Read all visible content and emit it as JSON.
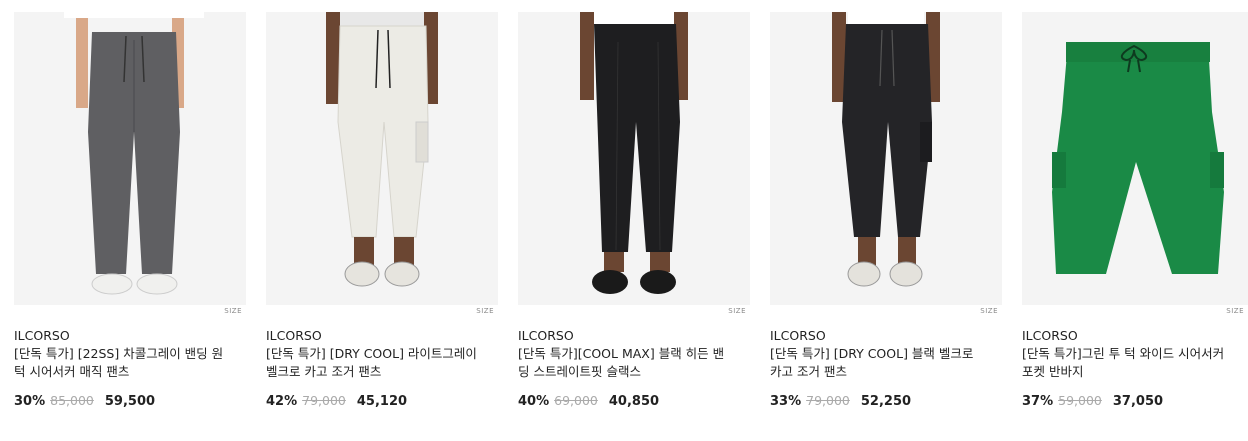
{
  "products": [
    {
      "size_label": "SIZE",
      "brand": "ILCORSO",
      "title": "[단독 특가] [22SS] 차콜그레이 밴딩 원 턱 시어서커 매직 팬츠",
      "discount": "30%",
      "original_price": "85,000",
      "price": "59,500",
      "pants_color": "#5f5f62",
      "shoe_color": "#f0f0ee"
    },
    {
      "size_label": "SIZE",
      "brand": "ILCORSO",
      "title": "[단독 특가] [DRY COOL] 라이트그레이 벨크로 카고 조거 팬츠",
      "discount": "42%",
      "original_price": "79,000",
      "price": "45,120",
      "pants_color": "#ecebe5",
      "shoe_color": "#e6e4de"
    },
    {
      "size_label": "SIZE",
      "brand": "ILCORSO",
      "title": "[단독 특가][COOL MAX] 블랙 히든 밴딩 스트레이트핏 슬랙스",
      "discount": "40%",
      "original_price": "69,000",
      "price": "40,850",
      "pants_color": "#1e1e20",
      "shoe_color": "#1a1a1a"
    },
    {
      "size_label": "SIZE",
      "brand": "ILCORSO",
      "title": "[단독 특가] [DRY COOL] 블랙 벨크로 카고 조거 팬츠",
      "discount": "33%",
      "original_price": "79,000",
      "price": "52,250",
      "pants_color": "#242427",
      "shoe_color": "#e4e2dc"
    },
    {
      "size_label": "SIZE",
      "brand": "ILCORSO",
      "title": "[단독 특가]그린 투 턱 와이드 시어서커 포켓 반바지",
      "discount": "37%",
      "original_price": "59,000",
      "price": "37,050",
      "pants_color": "#1a8a46",
      "shoe_color": ""
    }
  ]
}
